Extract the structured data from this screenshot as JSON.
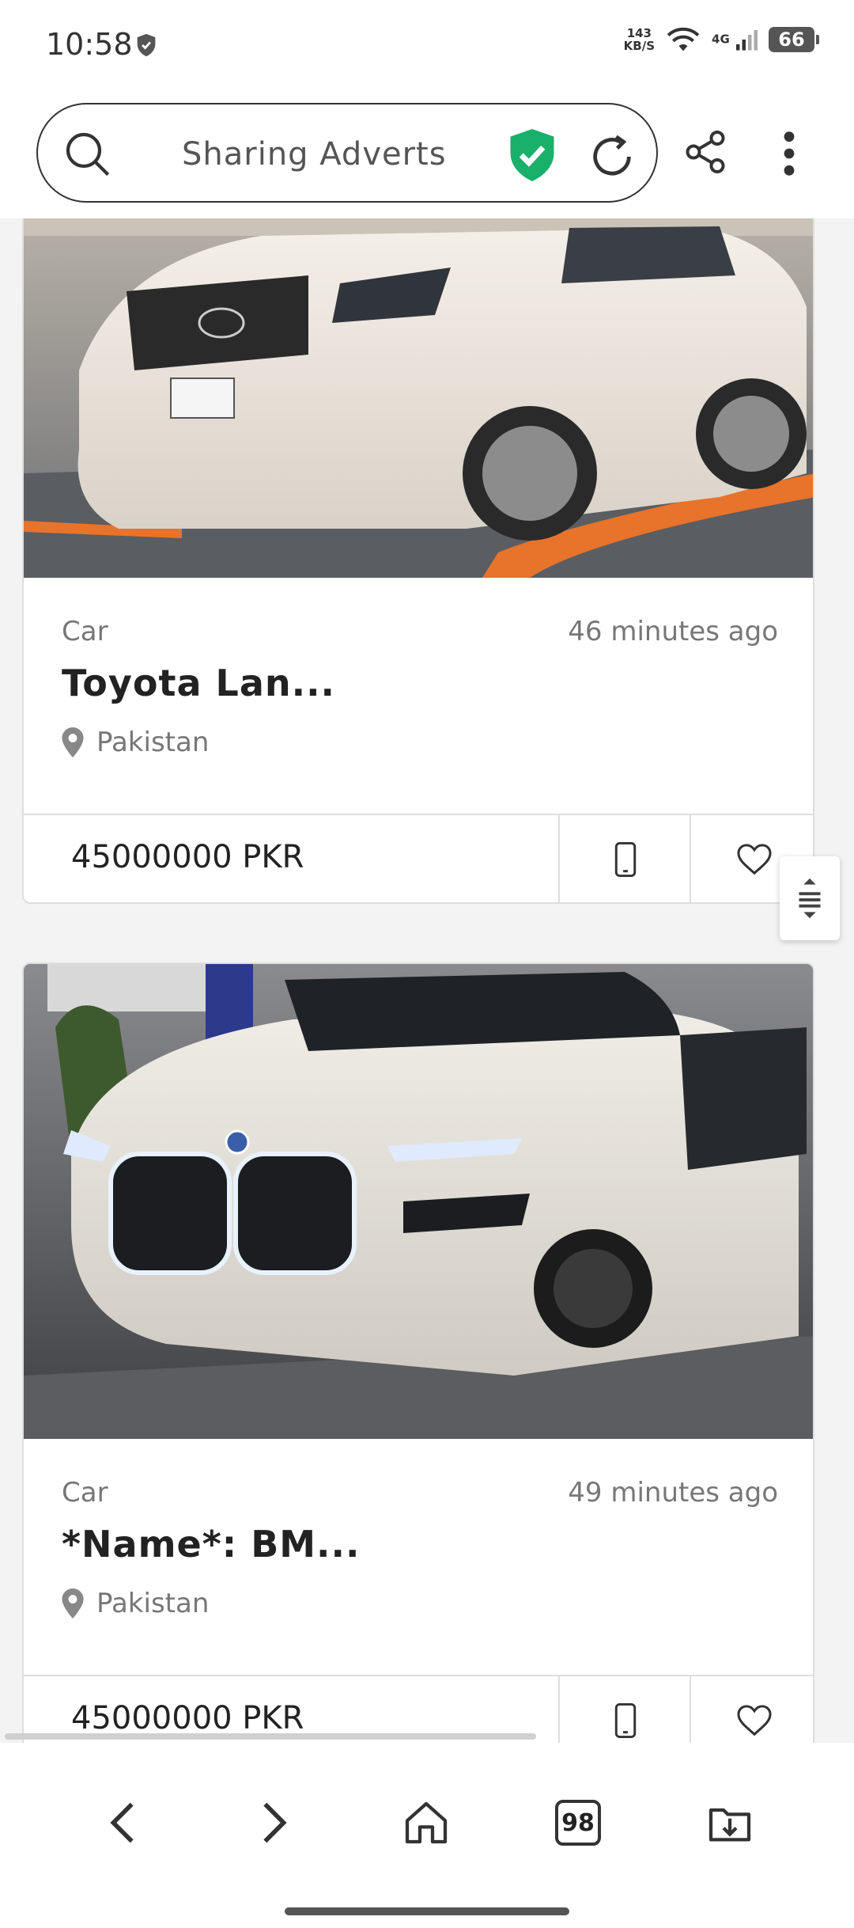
{
  "status_bar": {
    "time": "10:58",
    "speed_value": "143",
    "speed_unit": "KB/S",
    "network": "4G",
    "battery": "66"
  },
  "browser": {
    "url_text": "Sharing Adverts",
    "tabs_count": "98",
    "icons": [
      "search-icon",
      "shield-check-icon",
      "reload-icon",
      "share-icon",
      "more-vert-icon",
      "back-icon",
      "forward-icon",
      "home-icon",
      "tabs-icon",
      "downloads-icon"
    ]
  },
  "listings": [
    {
      "category": "Car",
      "time_ago": "46 minutes ago",
      "title": "Toyota Lan...",
      "location": "Pakistan",
      "price": "45000000 PKR",
      "photo": "white-toyota-land-cruiser"
    },
    {
      "category": "Car",
      "time_ago": "49 minutes ago",
      "title": "*Name*: BM...",
      "location": "Pakistan",
      "price": "45000000 PKR",
      "photo": "white-bmw-sedan"
    }
  ],
  "colors": {
    "accent_shield": "#18b06a",
    "text_primary": "#222222",
    "text_secondary": "#777777"
  }
}
